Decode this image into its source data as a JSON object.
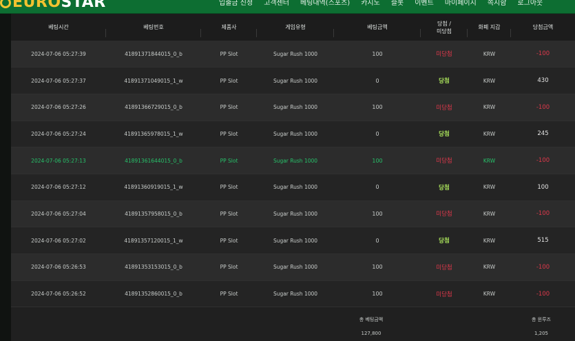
{
  "brand": {
    "logo_text_a": "EURO",
    "logo_text_b": "STAR"
  },
  "nav": [
    "입출금 신청",
    "고객센터",
    "베팅내역(스포츠)",
    "카지노",
    "슬롯",
    "이벤트",
    "마이페이지",
    "쪽지함",
    "로그아웃"
  ],
  "table": {
    "headers": [
      "베팅시간",
      "베팅번호",
      "제품사",
      "게임유형",
      "베팅금액",
      "당첨 /\n미당첨",
      "화폐 지갑",
      "당첨금액"
    ],
    "rows": [
      {
        "time": "2024-07-06 05:27:39",
        "id": "41891371844015_0_b",
        "provider": "PP Slot",
        "game": "Sugar Rush 1000",
        "bet": "100",
        "result": "미당첨",
        "currency": "KRW",
        "payout": "-100"
      },
      {
        "time": "2024-07-06 05:27:37",
        "id": "41891371049015_1_w",
        "provider": "PP Slot",
        "game": "Sugar Rush 1000",
        "bet": "0",
        "result": "당첨",
        "currency": "KRW",
        "payout": "430"
      },
      {
        "time": "2024-07-06 05:27:26",
        "id": "41891366729015_0_b",
        "provider": "PP Slot",
        "game": "Sugar Rush 1000",
        "bet": "100",
        "result": "미당첨",
        "currency": "KRW",
        "payout": "-100"
      },
      {
        "time": "2024-07-06 05:27:24",
        "id": "41891365978015_1_w",
        "provider": "PP Slot",
        "game": "Sugar Rush 1000",
        "bet": "0",
        "result": "당첨",
        "currency": "KRW",
        "payout": "245"
      },
      {
        "time": "2024-07-06 05:27:13",
        "id": "41891361644015_0_b",
        "provider": "PP Slot",
        "game": "Sugar Rush 1000",
        "bet": "100",
        "result": "미당첨",
        "currency": "KRW",
        "payout": "-100"
      },
      {
        "time": "2024-07-06 05:27:12",
        "id": "41891360919015_1_w",
        "provider": "PP Slot",
        "game": "Sugar Rush 1000",
        "bet": "0",
        "result": "당첨",
        "currency": "KRW",
        "payout": "100"
      },
      {
        "time": "2024-07-06 05:27:04",
        "id": "41891357958015_0_b",
        "provider": "PP Slot",
        "game": "Sugar Rush 1000",
        "bet": "100",
        "result": "미당첨",
        "currency": "KRW",
        "payout": "-100"
      },
      {
        "time": "2024-07-06 05:27:02",
        "id": "41891357120015_1_w",
        "provider": "PP Slot",
        "game": "Sugar Rush 1000",
        "bet": "0",
        "result": "당첨",
        "currency": "KRW",
        "payout": "515"
      },
      {
        "time": "2024-07-06 05:26:53",
        "id": "41891353153015_0_b",
        "provider": "PP Slot",
        "game": "Sugar Rush 1000",
        "bet": "100",
        "result": "미당첨",
        "currency": "KRW",
        "payout": "-100"
      },
      {
        "time": "2024-07-06 05:26:52",
        "id": "41891352860015_0_b",
        "provider": "PP Slot",
        "game": "Sugar Rush 1000",
        "bet": "100",
        "result": "미당첨",
        "currency": "KRW",
        "payout": "-100"
      }
    ]
  },
  "footer": {
    "total_bet_label": "총 베팅금액",
    "total_bet_value": "127,800",
    "total_win_label": "총 윈루즈",
    "total_win_value": "1,205"
  },
  "colors": {
    "brand_green": "#0d6e32",
    "loss_red": "#e0384b",
    "win_green": "#a8e05a",
    "highlight_green": "#27c26a",
    "logo_gold": "#f2c230"
  }
}
